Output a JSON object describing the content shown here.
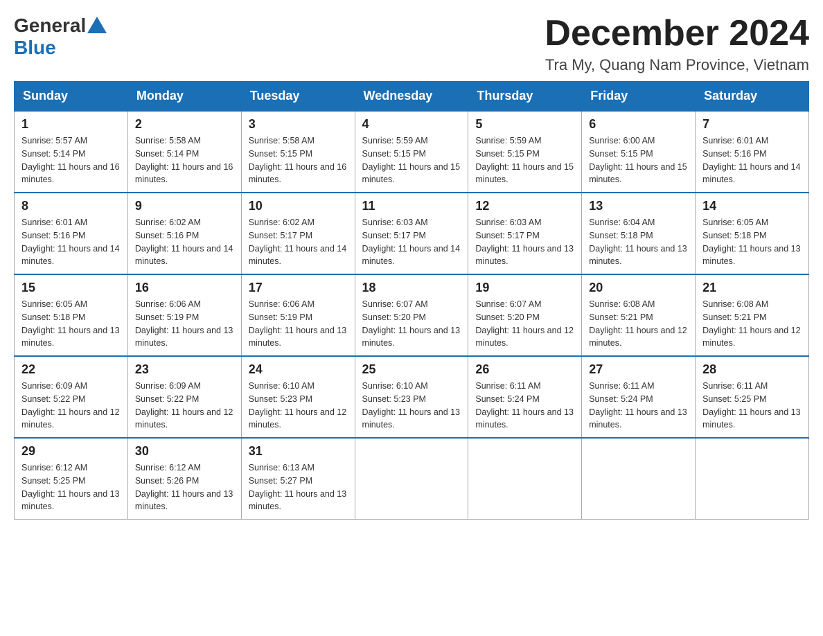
{
  "header": {
    "logo_general": "General",
    "logo_blue": "Blue",
    "month_title": "December 2024",
    "location": "Tra My, Quang Nam Province, Vietnam"
  },
  "weekdays": [
    "Sunday",
    "Monday",
    "Tuesday",
    "Wednesday",
    "Thursday",
    "Friday",
    "Saturday"
  ],
  "weeks": [
    [
      {
        "day": "1",
        "sunrise": "5:57 AM",
        "sunset": "5:14 PM",
        "daylight": "11 hours and 16 minutes."
      },
      {
        "day": "2",
        "sunrise": "5:58 AM",
        "sunset": "5:14 PM",
        "daylight": "11 hours and 16 minutes."
      },
      {
        "day": "3",
        "sunrise": "5:58 AM",
        "sunset": "5:15 PM",
        "daylight": "11 hours and 16 minutes."
      },
      {
        "day": "4",
        "sunrise": "5:59 AM",
        "sunset": "5:15 PM",
        "daylight": "11 hours and 15 minutes."
      },
      {
        "day": "5",
        "sunrise": "5:59 AM",
        "sunset": "5:15 PM",
        "daylight": "11 hours and 15 minutes."
      },
      {
        "day": "6",
        "sunrise": "6:00 AM",
        "sunset": "5:15 PM",
        "daylight": "11 hours and 15 minutes."
      },
      {
        "day": "7",
        "sunrise": "6:01 AM",
        "sunset": "5:16 PM",
        "daylight": "11 hours and 14 minutes."
      }
    ],
    [
      {
        "day": "8",
        "sunrise": "6:01 AM",
        "sunset": "5:16 PM",
        "daylight": "11 hours and 14 minutes."
      },
      {
        "day": "9",
        "sunrise": "6:02 AM",
        "sunset": "5:16 PM",
        "daylight": "11 hours and 14 minutes."
      },
      {
        "day": "10",
        "sunrise": "6:02 AM",
        "sunset": "5:17 PM",
        "daylight": "11 hours and 14 minutes."
      },
      {
        "day": "11",
        "sunrise": "6:03 AM",
        "sunset": "5:17 PM",
        "daylight": "11 hours and 14 minutes."
      },
      {
        "day": "12",
        "sunrise": "6:03 AM",
        "sunset": "5:17 PM",
        "daylight": "11 hours and 13 minutes."
      },
      {
        "day": "13",
        "sunrise": "6:04 AM",
        "sunset": "5:18 PM",
        "daylight": "11 hours and 13 minutes."
      },
      {
        "day": "14",
        "sunrise": "6:05 AM",
        "sunset": "5:18 PM",
        "daylight": "11 hours and 13 minutes."
      }
    ],
    [
      {
        "day": "15",
        "sunrise": "6:05 AM",
        "sunset": "5:18 PM",
        "daylight": "11 hours and 13 minutes."
      },
      {
        "day": "16",
        "sunrise": "6:06 AM",
        "sunset": "5:19 PM",
        "daylight": "11 hours and 13 minutes."
      },
      {
        "day": "17",
        "sunrise": "6:06 AM",
        "sunset": "5:19 PM",
        "daylight": "11 hours and 13 minutes."
      },
      {
        "day": "18",
        "sunrise": "6:07 AM",
        "sunset": "5:20 PM",
        "daylight": "11 hours and 13 minutes."
      },
      {
        "day": "19",
        "sunrise": "6:07 AM",
        "sunset": "5:20 PM",
        "daylight": "11 hours and 12 minutes."
      },
      {
        "day": "20",
        "sunrise": "6:08 AM",
        "sunset": "5:21 PM",
        "daylight": "11 hours and 12 minutes."
      },
      {
        "day": "21",
        "sunrise": "6:08 AM",
        "sunset": "5:21 PM",
        "daylight": "11 hours and 12 minutes."
      }
    ],
    [
      {
        "day": "22",
        "sunrise": "6:09 AM",
        "sunset": "5:22 PM",
        "daylight": "11 hours and 12 minutes."
      },
      {
        "day": "23",
        "sunrise": "6:09 AM",
        "sunset": "5:22 PM",
        "daylight": "11 hours and 12 minutes."
      },
      {
        "day": "24",
        "sunrise": "6:10 AM",
        "sunset": "5:23 PM",
        "daylight": "11 hours and 12 minutes."
      },
      {
        "day": "25",
        "sunrise": "6:10 AM",
        "sunset": "5:23 PM",
        "daylight": "11 hours and 13 minutes."
      },
      {
        "day": "26",
        "sunrise": "6:11 AM",
        "sunset": "5:24 PM",
        "daylight": "11 hours and 13 minutes."
      },
      {
        "day": "27",
        "sunrise": "6:11 AM",
        "sunset": "5:24 PM",
        "daylight": "11 hours and 13 minutes."
      },
      {
        "day": "28",
        "sunrise": "6:11 AM",
        "sunset": "5:25 PM",
        "daylight": "11 hours and 13 minutes."
      }
    ],
    [
      {
        "day": "29",
        "sunrise": "6:12 AM",
        "sunset": "5:25 PM",
        "daylight": "11 hours and 13 minutes."
      },
      {
        "day": "30",
        "sunrise": "6:12 AM",
        "sunset": "5:26 PM",
        "daylight": "11 hours and 13 minutes."
      },
      {
        "day": "31",
        "sunrise": "6:13 AM",
        "sunset": "5:27 PM",
        "daylight": "11 hours and 13 minutes."
      },
      null,
      null,
      null,
      null
    ]
  ]
}
